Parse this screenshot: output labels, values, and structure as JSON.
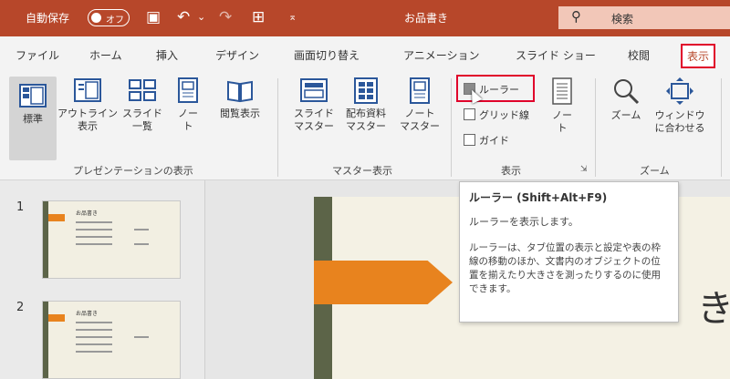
{
  "titlebar": {
    "autosave_label": "自動保存",
    "autosave_state": "オフ",
    "save_icon": "▣",
    "undo_icon": "↶",
    "undo_dropdown": "⌄",
    "redo_icon": "↷",
    "present_icon": "⊞",
    "customize_icon": "⌅",
    "doc_title": "お品書き",
    "search_placeholder": "検索"
  },
  "tabs": [
    "ファイル",
    "ホーム",
    "挿入",
    "デザイン",
    "画面切り替え",
    "アニメーション",
    "スライド ショー",
    "校閲",
    "表示"
  ],
  "ribbon": {
    "groups": {
      "presentation_views": "プレゼンテーションの表示",
      "master_views": "マスター表示",
      "show": "表示",
      "zoom": "ズーム"
    },
    "views": {
      "normal": "標準",
      "outline_1": "アウトライン",
      "outline_2": "表示",
      "sorter_1": "スライド",
      "sorter_2": "一覧",
      "notes_1": "ノー",
      "notes_2": "ト",
      "reading": "閲覧表示"
    },
    "masters": {
      "slide_1": "スライド",
      "slide_2": "マスター",
      "handout_1": "配布資料",
      "handout_2": "マスター",
      "notes_1": "ノート",
      "notes_2": "マスター"
    },
    "show": {
      "ruler": "ルーラー",
      "gridlines": "グリッド線",
      "guides": "ガイド",
      "notes_1": "ノー",
      "notes_2": "ト"
    },
    "zoom": {
      "zoom": "ズーム",
      "fit_1": "ウィンドウ",
      "fit_2": "に合わせる"
    }
  },
  "tooltip": {
    "title": "ルーラー (Shift+Alt+F9)",
    "desc": "ルーラーを表示します。",
    "body": "ルーラーは、タブ位置の表示と設定や表の枠線の移動のほか、文書内のオブジェクトの位置を揃えたり大きさを測ったりするのに使用できます。"
  },
  "slides": [
    {
      "number": "1",
      "title": "お品書き"
    },
    {
      "number": "2",
      "title": "お品書き"
    }
  ],
  "main_slide": {
    "visible_char": "き"
  }
}
